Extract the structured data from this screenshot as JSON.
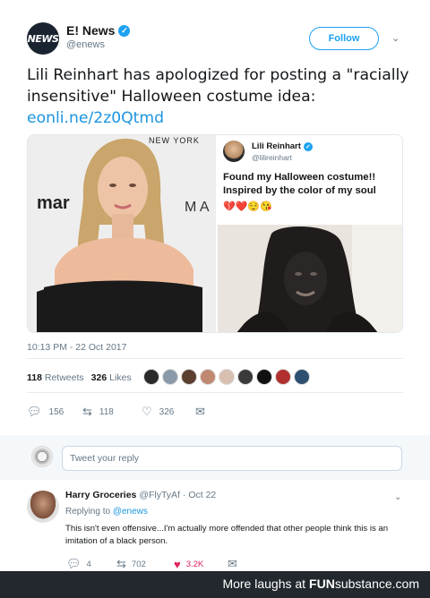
{
  "tweet": {
    "author_name": "E! News",
    "author_handle": "@enews",
    "avatar_text": "NEWS",
    "follow_label": "Follow",
    "text": "Lili Reinhart has apologized for posting a \"racially insensitive\" Halloween costume idea:",
    "link": "eonli.ne/2z0Qtmd",
    "timestamp": "10:13 PM - 22 Oct 2017",
    "retweets_count": "118",
    "retweets_label": "Retweets",
    "likes_count": "326",
    "likes_label": "Likes"
  },
  "media": {
    "backdrop_text_top": "NEW YORK",
    "backdrop_text_left": "mar",
    "backdrop_text_right": "M A",
    "quoted_name": "Lili Reinhart",
    "quoted_handle": "@lilireinhart",
    "quoted_text": "Found my Halloween costume!! Inspired by the color of my soul",
    "quoted_emojis": "💔❤️😌😘"
  },
  "actions": {
    "reply_count": "156",
    "retweet_count": "118",
    "like_count": "326"
  },
  "reply_box": {
    "placeholder": "Tweet your reply"
  },
  "reply": {
    "name": "Harry Groceries",
    "handle": "@FlyTyAf",
    "date": "· Oct 22",
    "replying_label": "Replying to",
    "replying_to": "@enews",
    "text": "This isn't even offensive...I'm actually more offended that other people think this is an imitation of a black person.",
    "reply_count": "4",
    "retweet_count": "702",
    "like_count": "3.2K"
  },
  "footer": {
    "prefix": "More laughs at",
    "brand_fun": "FUN",
    "brand_sub": "substance.com"
  },
  "colors": {
    "accent": "#1da1f2",
    "link": "#1b95e0",
    "like_red": "#e0245e",
    "footer_bg": "#23272e"
  },
  "icons": [
    "verified-badge-icon",
    "chevron-down-icon",
    "reply-icon",
    "retweet-icon",
    "heart-icon",
    "message-icon"
  ]
}
